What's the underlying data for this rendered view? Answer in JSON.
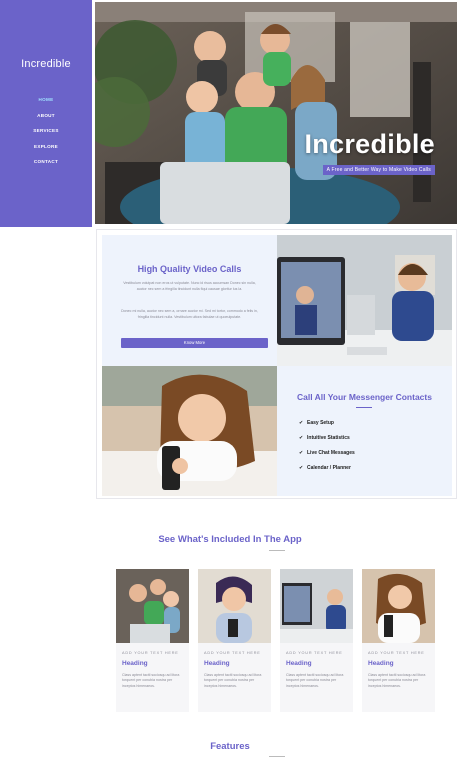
{
  "sidebar": {
    "brand": "Incredible",
    "nav": [
      "HOME",
      "ABOUT",
      "SERVICES",
      "EXPLORE",
      "CONTACT"
    ]
  },
  "hero": {
    "title": "Incredible",
    "tagline": "A Free and Better Way to Make Video Calls"
  },
  "features": {
    "video": {
      "title": "High Quality Video Calls",
      "para1": "Vestibulum volutpat non eros ut vulputate. Nunc id risus accumsan Donec sin nulla, auctor nec sem a fringilla tincidunt nulla fiqui causae gloritur lus la.",
      "para2": "Donec mi nulla, auctor nec sem a, ornare auctor mi. Sed mi tortor, commodo a felis in, fringilla tincidunt nulla. Vestibulum ultora fabulae ut quoeulputate.",
      "button": "Know More"
    },
    "contacts": {
      "title": "Call All Your Messenger Contacts",
      "items": [
        "Easy Setup",
        "Intuitive Statistics",
        "Live Chat Messages",
        "Calendar / Planner"
      ]
    }
  },
  "included": {
    "title": "See What's Included In The App",
    "cards": [
      {
        "kicker": "ADD YOUR TEXT HERE",
        "heading": "Heading",
        "text": "Class aptent taciti sociosqu ad litora torquent per conubia nostra per inceptos himenaeos."
      },
      {
        "kicker": "ADD YOUR TEXT HERE",
        "heading": "Heading",
        "text": "Class aptent taciti sociosqu ad litora torquent per conubia nostra per inceptos himenaeos."
      },
      {
        "kicker": "ADD YOUR TEXT HERE",
        "heading": "Heading",
        "text": "Class aptent taciti sociosqu ad litora torquent per conubia nostra per inceptos himenaeos."
      },
      {
        "kicker": "ADD YOUR TEXT HERE",
        "heading": "Heading",
        "text": "Class aptent taciti sociosqu ad litora torquent per conubia nostra per inceptos himenaeos."
      }
    ]
  },
  "features_section": {
    "title": "Features"
  },
  "colors": {
    "accent": "#6b63c9",
    "nav_active": "#9fe0ff",
    "panel_bg": "#eef3fc"
  }
}
